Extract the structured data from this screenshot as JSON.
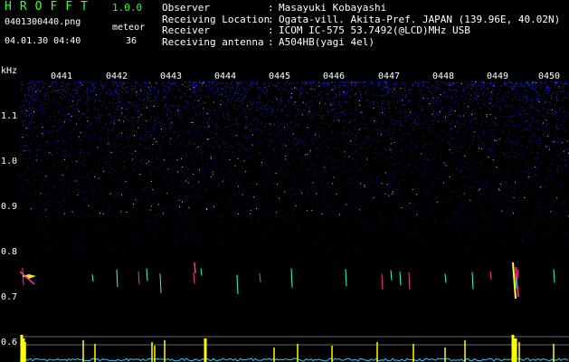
{
  "header": {
    "app_title": "HROFFT",
    "app_version": "1.0.0",
    "filename": "0401300440.png",
    "meteor_label": "meteor",
    "datetime": "04.01.30 04:40",
    "meteor_count": "36"
  },
  "info": [
    {
      "key": "Observer",
      "sep": ":",
      "value": "Masayuki Kobayashi"
    },
    {
      "key": "Receiving Location",
      "sep": ":",
      "value": "Ogata-vill. Akita-Pref. JAPAN (139.96E, 40.02N)"
    },
    {
      "key": "Receiver",
      "sep": ":",
      "value": "ICOM IC-575 53.7492(@LCD)MHz USB"
    },
    {
      "key": "Receiving antenna",
      "sep": ":",
      "value": "A504HB(yagi 4el)"
    }
  ],
  "spectrogram": {
    "y_unit": "kHz",
    "y_ticks": [
      "1.1",
      "1.0",
      "0.9",
      "0.8",
      "0.7",
      "0.6"
    ],
    "x_ticks": [
      "0441",
      "0442",
      "0443",
      "0444",
      "0445",
      "0446",
      "0447",
      "0448",
      "0449",
      "0450"
    ],
    "colors": {
      "noise": "#2a2aff",
      "echo_hot": "#ffff33",
      "echo_warm": "#ff3399",
      "echo_cool": "#33ffcc",
      "baseline": "#33ccff",
      "peak": "#ffff00"
    }
  }
}
